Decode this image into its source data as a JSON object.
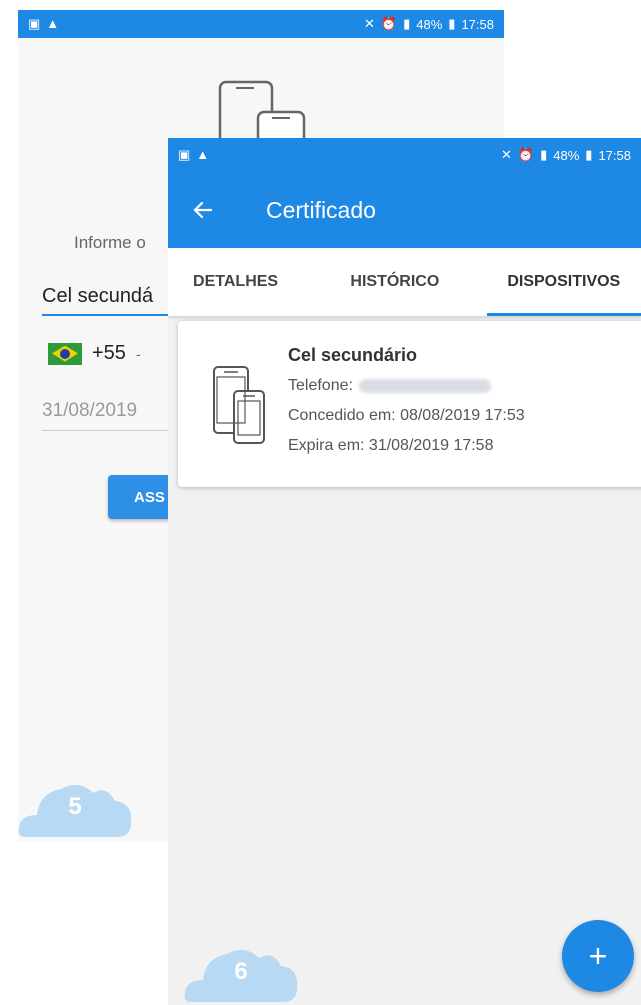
{
  "screen5": {
    "status_time": "17:58",
    "battery": "48%",
    "inform_text": "Informe o",
    "name_value": "Cel secundá",
    "country_code": "+55",
    "country_chevron": "-",
    "date_value": "31/08/2019",
    "assign_button": "ASS",
    "step_badge": "5"
  },
  "screen6": {
    "status_time": "17:58",
    "battery": "48%",
    "title": "Certificado",
    "tabs": [
      "DETALHES",
      "HISTÓRICO",
      "DISPOSITIVOS"
    ],
    "device": {
      "name": "Cel secundário",
      "phone_label": "Telefone:",
      "granted": "Concedido em: 08/08/2019 17:53",
      "expires": "Expira em: 31/08/2019 17:58"
    },
    "fab_label": "+",
    "step_badge": "6"
  },
  "colors": {
    "primary": "#1e88e5",
    "cloud": "#b8d9f3"
  },
  "icons": [
    "back-arrow-icon",
    "devices-icon",
    "add-icon",
    "image-icon",
    "warning-icon",
    "mute-icon",
    "alarm-icon",
    "signal-icon",
    "battery-icon"
  ]
}
